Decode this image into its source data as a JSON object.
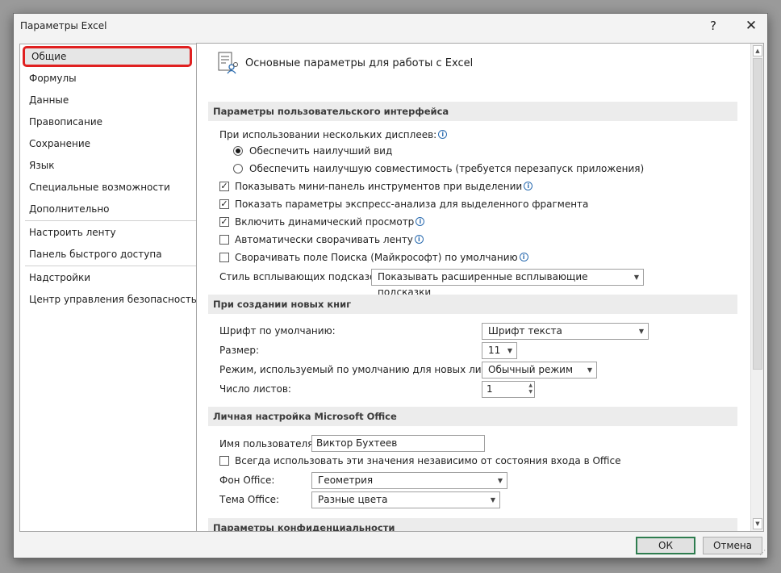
{
  "window": {
    "title": "Параметры Excel",
    "help": "?",
    "close": "✕"
  },
  "nav": {
    "items": [
      {
        "label": "Общие"
      },
      {
        "label": "Формулы"
      },
      {
        "label": "Данные"
      },
      {
        "label": "Правописание"
      },
      {
        "label": "Сохранение"
      },
      {
        "label": "Язык"
      },
      {
        "label": "Специальные возможности"
      },
      {
        "label": "Дополнительно"
      },
      {
        "label": "Настроить ленту"
      },
      {
        "label": "Панель быстрого доступа"
      },
      {
        "label": "Надстройки"
      },
      {
        "label": "Центр управления безопасностью"
      }
    ]
  },
  "main": {
    "header": "Основные параметры для работы с Excel",
    "ui_section": {
      "title": "Параметры пользовательского интерфейса",
      "multi_display_label": "При использовании нескольких дисплеев:",
      "radio_best_view": "Обеспечить наилучший вид",
      "radio_compat": "Обеспечить наилучшую совместимость (требуется перезапуск приложения)",
      "cb_mini_toolbar": "Показывать мини-панель инструментов при выделении",
      "cb_quick_analysis": "Показать параметры экспресс-анализа для выделенного фрагмента",
      "cb_live_preview": "Включить динамический просмотр",
      "cb_collapse_ribbon": "Автоматически сворачивать ленту",
      "cb_collapse_search": "Сворачивать поле Поиска (Майкрософт) по умолчанию",
      "tooltip_style_label": "Стиль всплывающих подсказок:",
      "tooltip_style_value": "Показывать расширенные всплывающие подсказки"
    },
    "new_book_section": {
      "title": "При создании новых книг",
      "font_label": "Шрифт по умолчанию:",
      "font_value": "Шрифт текста",
      "size_label": "Размер:",
      "size_value": "11",
      "view_label": "Режим, используемый по умолчанию для новых листов:",
      "view_value": "Обычный режим",
      "sheets_label": "Число листов:",
      "sheets_value": "1"
    },
    "personal_section": {
      "title": "Личная настройка Microsoft Office",
      "username_label": "Имя пользователя:",
      "username_value": "Виктор Бухтеев",
      "always_use_label": "Всегда использовать эти значения независимо от состояния входа в Office",
      "background_label": "Фон Office:",
      "background_value": "Геометрия",
      "theme_label": "Тема Office:",
      "theme_value": "Разные цвета"
    },
    "privacy_section": {
      "title": "Параметры конфиденциальности"
    }
  },
  "buttons": {
    "ok": "ОК",
    "cancel": "Отмена"
  },
  "colors": {
    "selection_outline": "#e02020",
    "ok_border": "#2e7d4f"
  }
}
